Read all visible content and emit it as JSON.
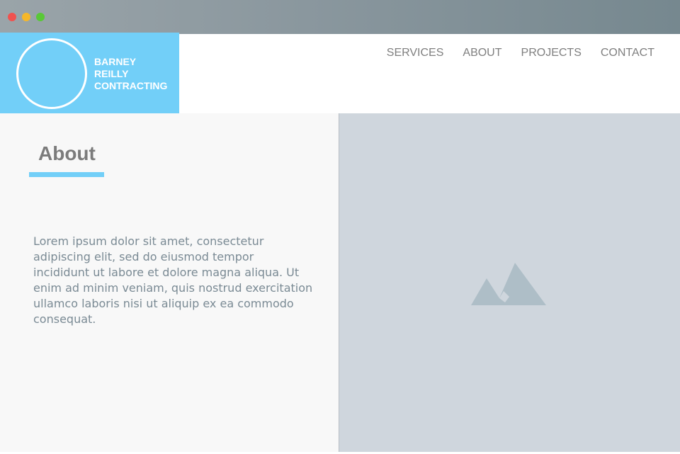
{
  "window": {
    "buttons": [
      "close",
      "minimize",
      "maximize"
    ]
  },
  "brand": {
    "lines": [
      "BARNEY",
      "REILLY",
      "CONTRACTING"
    ]
  },
  "nav": {
    "items": [
      "SERVICES",
      "ABOUT",
      "PROJECTS",
      "CONTACT"
    ]
  },
  "about": {
    "title": "About",
    "body": "Lorem ipsum dolor sit amet, consectetur adipiscing elit, sed do eiusmod tempor incididunt ut labore et dolore magna aliqua. Ut enim ad minim veniam, quis nostrud exercitation ullamco laboris nisi ut aliquip ex ea commodo consequat."
  },
  "media": {
    "icon": "image-placeholder-icon"
  },
  "colors": {
    "accent": "#72cff8",
    "panel_gray": "#cfd6dd",
    "text_gray": "#7f7f7f"
  }
}
